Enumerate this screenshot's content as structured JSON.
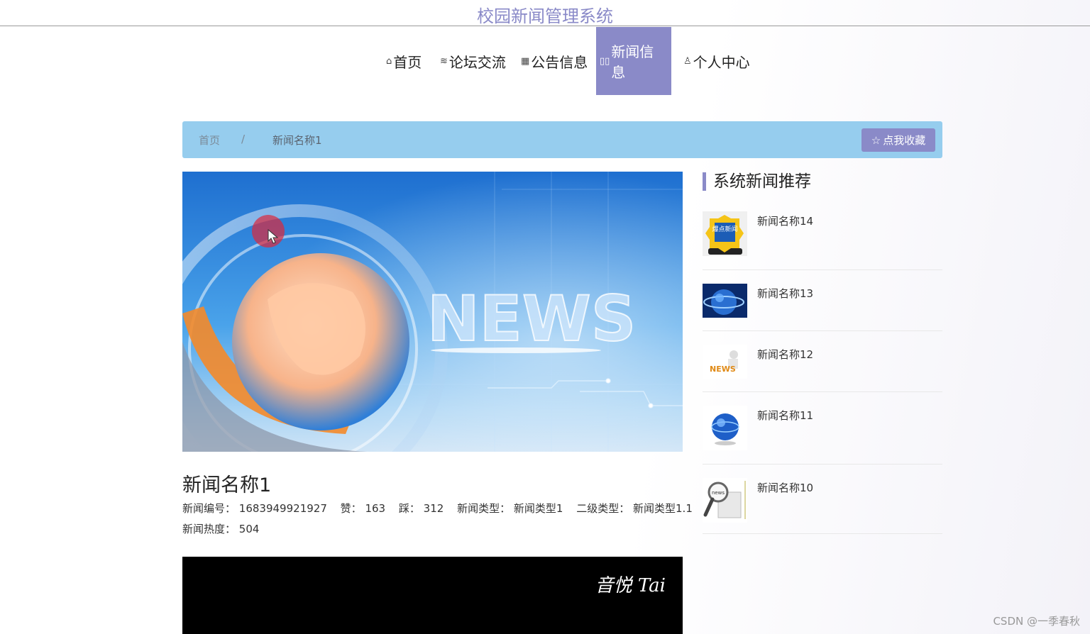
{
  "site": {
    "title": "校园新闻管理系统"
  },
  "nav": {
    "items": [
      {
        "icon": "home-icon",
        "label": "首页"
      },
      {
        "icon": "forum-icon",
        "label": "论坛交流"
      },
      {
        "icon": "announcement-icon",
        "label": "公告信息"
      },
      {
        "icon": "news-icon",
        "label": "新闻信息",
        "active": true
      },
      {
        "icon": "user-icon",
        "label": "个人中心"
      }
    ]
  },
  "breadcrumb": {
    "home": "首页",
    "separator": "/",
    "current": "新闻名称1",
    "favorite_label": "点我收藏"
  },
  "article": {
    "title": "新闻名称1",
    "fields": [
      {
        "key": "新闻编号：",
        "value": "1683949921927"
      },
      {
        "key": "赞：",
        "value": "163"
      },
      {
        "key": "踩：",
        "value": "312"
      },
      {
        "key": "新闻类型：",
        "value": "新闻类型1"
      },
      {
        "key": "二级类型：",
        "value": "新闻类型1.1"
      }
    ],
    "heat_key": "新闻热度：",
    "heat_value": "504",
    "hero_text": "NEWS",
    "video_watermark": "音悦 Tai"
  },
  "sidebar": {
    "title": "系统新闻推荐",
    "items": [
      {
        "name": "新闻名称14",
        "thumb_text": "爆点新闻"
      },
      {
        "name": "新闻名称13"
      },
      {
        "name": "新闻名称12",
        "thumb_text": "NEWS"
      },
      {
        "name": "新闻名称11"
      },
      {
        "name": "新闻名称10",
        "thumb_text": "news"
      }
    ]
  },
  "watermark": "CSDN @一季春秋",
  "colors": {
    "accent": "#8a8ac8",
    "breadcrumb_bg": "#96cdee"
  }
}
